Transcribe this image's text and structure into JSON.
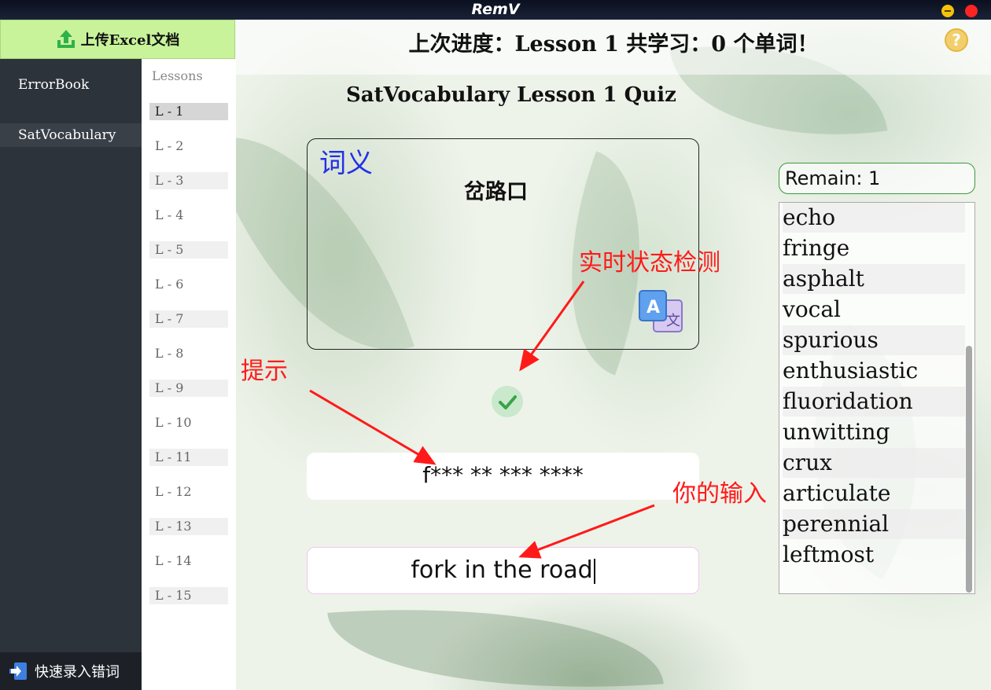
{
  "window": {
    "title": "RemV"
  },
  "sidebar": {
    "upload_label": "上传Excel文档",
    "items": [
      {
        "label": "ErrorBook"
      },
      {
        "label": "SatVocabulary"
      }
    ],
    "quick_entry_label": "快速录入错词"
  },
  "lessons": {
    "header": "Lessons",
    "items": [
      "L - 1",
      "L - 2",
      "L - 3",
      "L - 4",
      "L - 5",
      "L - 6",
      "L - 7",
      "L - 8",
      "L - 9",
      "L - 10",
      "L - 11",
      "L - 12",
      "L - 13",
      "L - 14",
      "L - 15"
    ]
  },
  "main": {
    "progress_title": "上次进度：Lesson 1  共学习：0 个单词！",
    "help_glyph": "?",
    "quiz_title": "SatVocabulary Lesson 1 Quiz",
    "meaning_label": "词义",
    "meaning_text": "岔路口",
    "hint_text": "f*** ** *** ****",
    "input_value": "fork in the road"
  },
  "remain": {
    "label": "Remain: 1"
  },
  "word_list": [
    "echo",
    "fringe",
    "asphalt",
    "vocal",
    "spurious",
    "enthusiastic",
    "fluoridation",
    "unwitting",
    "crux",
    "articulate",
    "perennial",
    "leftmost"
  ],
  "annotations": {
    "realtime": "实时状态检测",
    "hint": "提示",
    "your_input": "你的输入"
  },
  "colors": {
    "accent_green": "#c8f39a",
    "sidebar_bg": "#2d333b",
    "annotation_red": "#ff1a1a",
    "meaning_blue": "#2230e6"
  }
}
